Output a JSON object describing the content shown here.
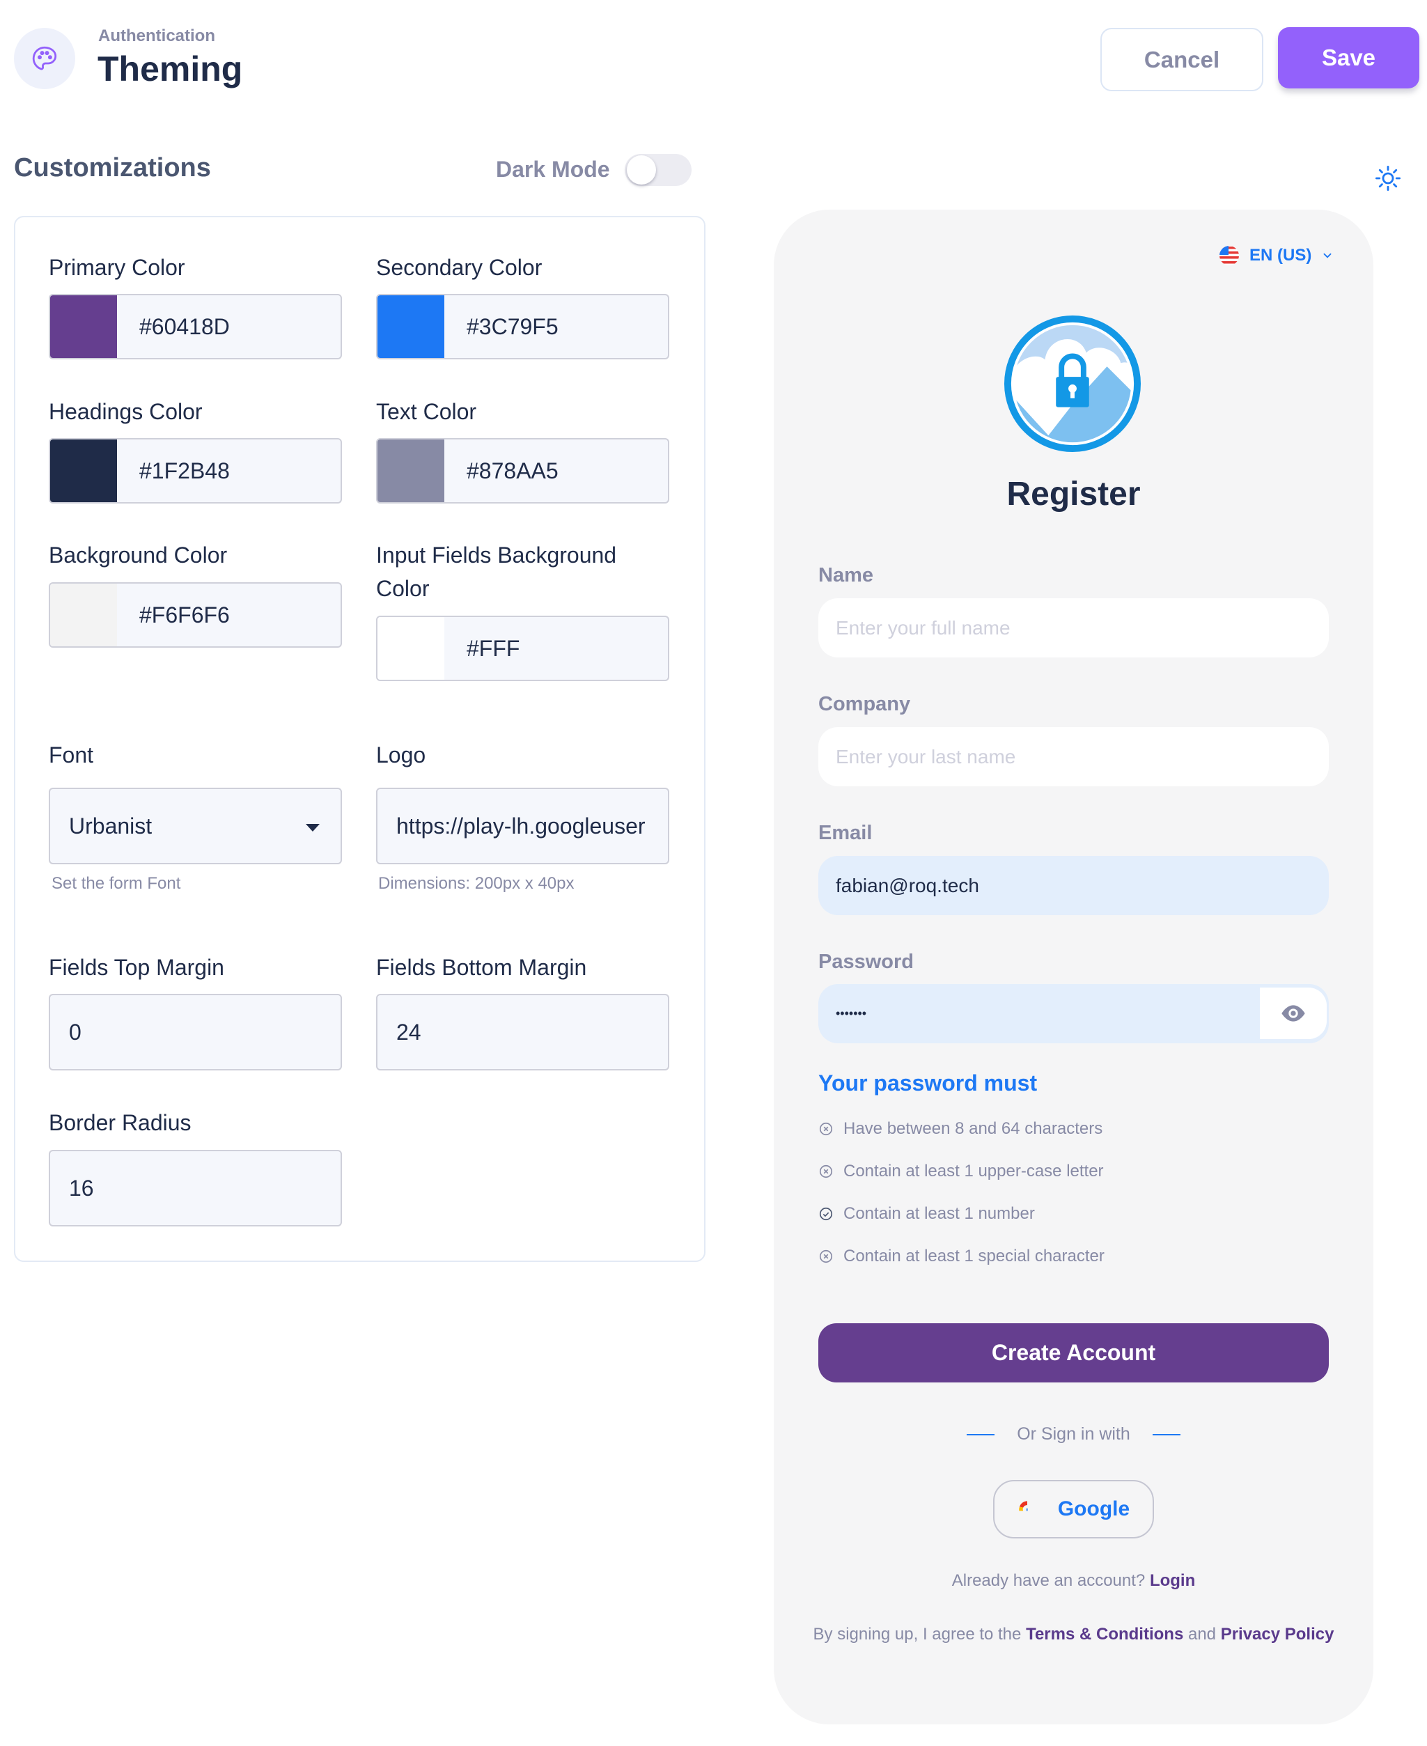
{
  "header": {
    "breadcrumb": "Authentication",
    "title": "Theming",
    "icon": "palette-icon",
    "cancel_label": "Cancel",
    "save_label": "Save"
  },
  "customizations": {
    "title": "Customizations",
    "dark_mode_label": "Dark Mode",
    "dark_mode_on": false,
    "theme_icon": "sun-icon",
    "colors": [
      {
        "label": "Primary Color",
        "value": "#60418D",
        "swatch": "#653E8F"
      },
      {
        "label": "Secondary Color",
        "value": "#3C79F5",
        "swatch": "#1D78F4"
      },
      {
        "label": "Headings Color",
        "value": "#1F2B48",
        "swatch": "#1F2B48"
      },
      {
        "label": "Text Color",
        "value": "#878AA5",
        "swatch": "#878AA5"
      },
      {
        "label": "Background Color",
        "value": "#F6F6F6",
        "swatch": "#F6F6F6"
      },
      {
        "label": "Input Fields Background Color",
        "value": "#FFF",
        "swatch": "#FFFFFF"
      }
    ],
    "font": {
      "label": "Font",
      "value": "Urbanist",
      "helper": "Set the form Font"
    },
    "logo": {
      "label": "Logo",
      "value": "https://play-lh.googleuser",
      "helper": "Dimensions: 200px x 40px"
    },
    "fields_top_margin": {
      "label": "Fields Top Margin",
      "value": "0"
    },
    "fields_bottom_margin": {
      "label": "Fields Bottom Margin",
      "value": "24"
    },
    "border_radius": {
      "label": "Border Radius",
      "value": "16"
    }
  },
  "preview": {
    "language": "EN (US)",
    "title": "Register",
    "fields": {
      "name": {
        "label": "Name",
        "placeholder": "Enter your full name",
        "value": ""
      },
      "company": {
        "label": "Company",
        "placeholder": "Enter your last name",
        "value": ""
      },
      "email": {
        "label": "Email",
        "value": "fabian@roq.tech"
      },
      "password": {
        "label": "Password",
        "value": "•••••••"
      }
    },
    "password_rules_title": "Your password must",
    "password_rules": [
      {
        "text": "Have between 8 and 64 characters",
        "met": false
      },
      {
        "text": "Contain at least 1 upper-case letter",
        "met": false
      },
      {
        "text": "Contain at least 1 number",
        "met": true
      },
      {
        "text": "Contain at least 1 special character",
        "met": false
      }
    ],
    "create_account_label": "Create Account",
    "or_sign_in_with": "Or Sign in with",
    "google_label": "Google",
    "already_have_account": "Already have an account?",
    "login_label": "Login",
    "terms_prefix": "By signing up, I agree to the",
    "terms_label": "Terms & Conditions",
    "terms_and": "and",
    "privacy_label": "Privacy Policy"
  }
}
